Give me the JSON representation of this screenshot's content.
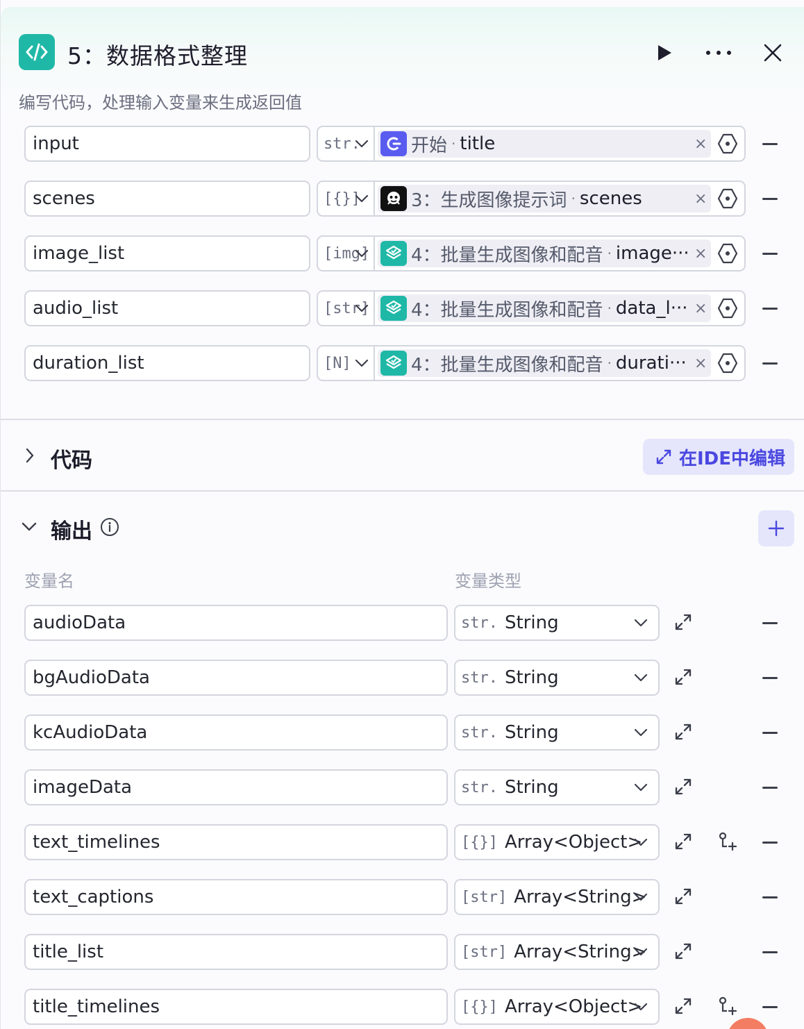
{
  "header": {
    "title": "5：数据格式整理",
    "subtitle": "编写代码，处理输入变量来生成返回值",
    "icon": "code-icon"
  },
  "inputs": [
    {
      "name": "input",
      "type_glyph": "str.",
      "node_no": "",
      "node_title": "开始",
      "var": "title",
      "node_icon": "start-node-icon",
      "node_color": "#5a5cf0"
    },
    {
      "name": "scenes",
      "type_glyph": "[{}]",
      "node_no": "3：",
      "node_title": "生成图像提示词",
      "var": "scenes",
      "node_icon": "llm-node-icon",
      "node_color": "#111111"
    },
    {
      "name": "image_list",
      "type_glyph": "[img]",
      "node_no": "4：",
      "node_title": "批量生成图像和配音",
      "var": "image···",
      "node_icon": "batch-node-icon",
      "node_color": "#1fb8a7"
    },
    {
      "name": "audio_list",
      "type_glyph": "[str]",
      "node_no": "4：",
      "node_title": "批量生成图像和配音",
      "var": "data_l···",
      "node_icon": "batch-node-icon",
      "node_color": "#1fb8a7"
    },
    {
      "name": "duration_list",
      "type_glyph": "[N]",
      "node_no": "4：",
      "node_title": "批量生成图像和配音",
      "var": "durati···",
      "node_icon": "batch-node-icon",
      "node_color": "#1fb8a7"
    }
  ],
  "code_section": {
    "title": "代码",
    "ide_button": "在IDE中编辑"
  },
  "output_section": {
    "title": "输出",
    "col_name": "变量名",
    "col_type": "变量类型"
  },
  "outputs": [
    {
      "name": "audioData",
      "glyph": "str.",
      "type": "String",
      "has_child": false
    },
    {
      "name": "bgAudioData",
      "glyph": "str.",
      "type": "String",
      "has_child": false
    },
    {
      "name": "kcAudioData",
      "glyph": "str.",
      "type": "String",
      "has_child": false
    },
    {
      "name": "imageData",
      "glyph": "str.",
      "type": "String",
      "has_child": false
    },
    {
      "name": "text_timelines",
      "glyph": "[{}]",
      "type": "Array<Object>",
      "has_child": true
    },
    {
      "name": "text_captions",
      "glyph": "[str]",
      "type": "Array<String>",
      "has_child": false
    },
    {
      "name": "title_list",
      "glyph": "[str]",
      "type": "Array<String>",
      "has_child": false
    },
    {
      "name": "title_timelines",
      "glyph": "[{}]",
      "type": "Array<Object>",
      "has_child": true
    }
  ],
  "colors": {
    "accent": "#4a47e0",
    "teal": "#1fb8a7",
    "border": "#d4d6df"
  }
}
